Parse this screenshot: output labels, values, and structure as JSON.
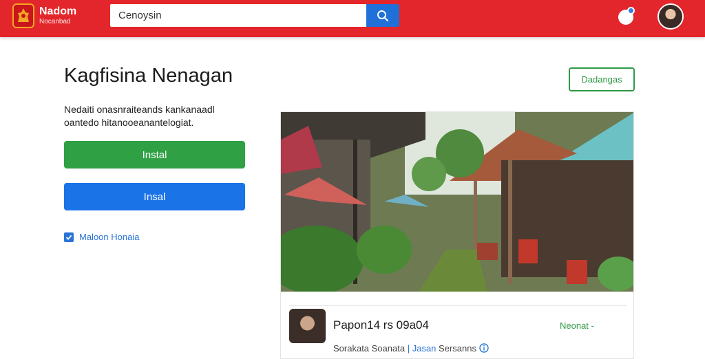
{
  "header": {
    "logo_title": "Nadom",
    "logo_sub": "Nocanbad",
    "search": {
      "value": "Cenoysin",
      "placeholder": ""
    },
    "colors": {
      "bar": "#e3262b",
      "search_button": "#1f70d9"
    }
  },
  "main": {
    "title": "Kagfisina Nenagan",
    "description": "Nedaiti onasnraiteands kankanaadl oantedo hitanooeanantelogiat.",
    "primary_button": "Instal",
    "secondary_button": "Insal",
    "checkbox_label": "Maloon Honaia",
    "checkbox_checked": true,
    "outline_button": "Dadangas"
  },
  "card": {
    "name": "Papon14 rs 09a04",
    "status": "Neonat -",
    "meta_left": "Sorakata Soanata",
    "meta_separator": "|",
    "meta_link": "Jasan",
    "meta_right": "Sersanns",
    "meta_icon": "info-icon"
  },
  "icons": {
    "logo": "temple-logo-icon",
    "search": "search-icon",
    "notification": "notification-icon",
    "checkbox": "checkmark-icon"
  }
}
